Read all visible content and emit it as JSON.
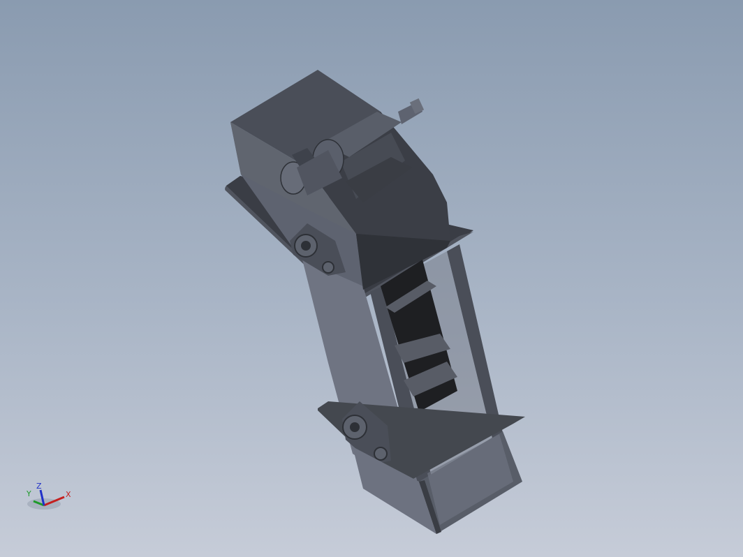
{
  "viewport": {
    "background_top": "#8a9bb0",
    "background_bottom": "#c6ccd8",
    "model": "screen-conveyor-assembly"
  },
  "triad": {
    "x_label": "X",
    "y_label": "Y",
    "z_label": "Z",
    "x_color": "#c42020",
    "y_color": "#1e9a2a",
    "z_color": "#2030c8"
  },
  "colors": {
    "body_dark": "#3e424b",
    "body_mid": "#5a5f6b",
    "body_light": "#727885",
    "frame": "#4a4e58",
    "belt": "#1e1f22"
  }
}
